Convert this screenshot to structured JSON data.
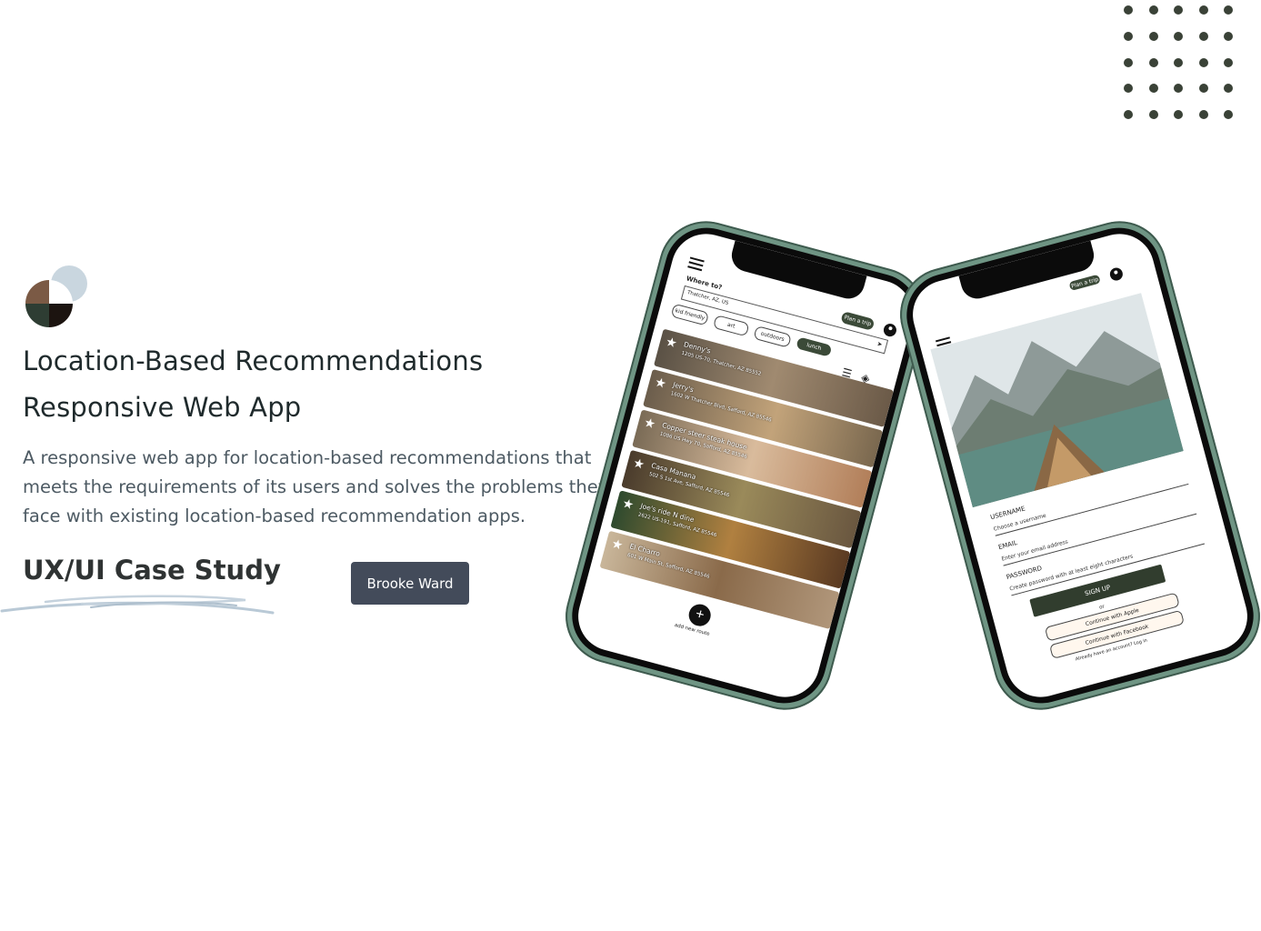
{
  "hero": {
    "title_line1": "Location-Based Recommendations",
    "title_line2": "Responsive Web App",
    "description": "A responsive web app for location-based recommendations that meets the requirements of its users and solves the problems they  face with existing location-based recommendation apps.",
    "subtitle": "UX/UI Case Study",
    "author_button": "Brooke Ward"
  },
  "colors": {
    "accent_dark": "#434b5a",
    "brand_green": "#3b4a38",
    "phone_frame": "#6f9584",
    "logo_brown": "#7b5a45",
    "logo_light": "#c9d6df"
  },
  "phone_search": {
    "where_label": "Where to?",
    "location_value": "Thatcher, AZ, US",
    "plan_trip": "Plan a trip",
    "filters": [
      "kid friendly",
      "art",
      "outdoors",
      "lunch"
    ],
    "results": [
      {
        "name": "Denny's",
        "address": "1205 US-70, Thatcher, AZ 85552"
      },
      {
        "name": "Jerry's",
        "address": "1602 W Thatcher Blvd, Safford, AZ 85546"
      },
      {
        "name": "Copper steer steak house",
        "address": "1086 US Hwy 70, Safford, AZ 85546"
      },
      {
        "name": "Casa Manana",
        "address": "502 S 1st Ave, Safford, AZ 85546"
      },
      {
        "name": "Joe's ride N dine",
        "address": "2622 US-191, Safford, AZ 85546"
      },
      {
        "name": "El Charro",
        "address": "601 W Main St, Safford, AZ 85546"
      }
    ],
    "add_route": "add new route"
  },
  "phone_signup": {
    "plan_trip": "Plan a trip",
    "username_label": "USERNAME",
    "username_hint": "Choose a username",
    "email_label": "EMAIL",
    "email_hint": "Enter your email address",
    "password_label": "PASSWORD",
    "password_hint": "Create password with at least eight characters",
    "signup_button": "SIGN UP",
    "or_text": "or",
    "apple_button": "Continue with Apple",
    "facebook_button": "Continue with Facebook",
    "login_prompt": "Already have an account? Log in"
  }
}
